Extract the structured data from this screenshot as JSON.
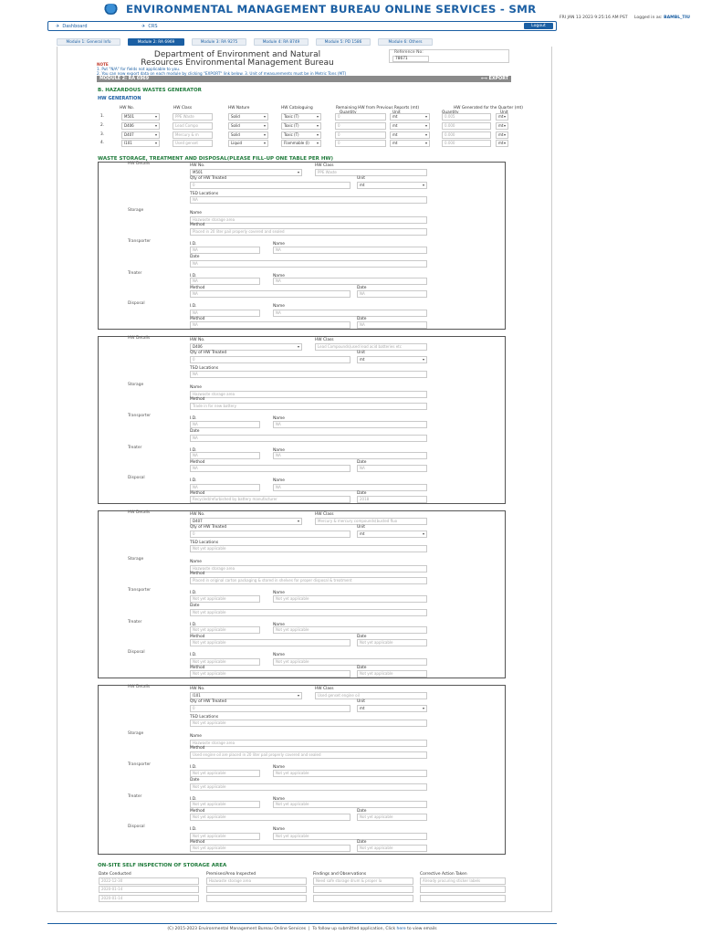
{
  "header": {
    "title": "ENVIRONMENTAL MANAGEMENT BUREAU ONLINE SERVICES - SMR",
    "datetime": "FRI JAN 13 2023 9:25:16 AM PST",
    "logged_in_label": "Logged in as:",
    "user": "BAMBL_TIU"
  },
  "nav": {
    "dashboard": "Dashboard",
    "crs": "CRS",
    "logout": "Logout"
  },
  "tabs": [
    {
      "label": "Module 1: General Info",
      "active": false
    },
    {
      "label": "Module 2: RA 6969",
      "active": true
    },
    {
      "label": "Module 3: RA 9275",
      "active": false
    },
    {
      "label": "Module 4: RA 8749",
      "active": false
    },
    {
      "label": "Module 5: PD 1586",
      "active": false
    },
    {
      "label": "Module 6: Others",
      "active": false
    }
  ],
  "dept": {
    "line1": "Department of Environment and Natural",
    "line2": "Resources Environmental Management Bureau"
  },
  "reference": {
    "label": "Reference No:",
    "value": "78671"
  },
  "note": {
    "label": "NOTE",
    "line1": "1. Put \"N/A\" for fields not applicable to you.",
    "line2": "2. You can now export data on each module by clicking \"EXPORT\" link below.  3. Unit of measurements must be in Metric Tons (MT)"
  },
  "module_bar": {
    "label": "MODULE 2: RA 6969",
    "export": "EXPORT"
  },
  "section_b": "B. HAZARDOUS WASTES GENERATOR",
  "hw_generation": {
    "title": "HW GENERATION",
    "headers": {
      "no": "HW No.",
      "class": "HW Class",
      "nature": "HW Nature",
      "cat": "HW Cataloguing",
      "remaining": "Remaining HW from Previous Reports (mt)",
      "quantity": "Quantity",
      "unit": "Unit",
      "generated": "HW Generated for the Quarter (mt)"
    },
    "rows": [
      {
        "n": "1.",
        "hw": "M501",
        "cls": "PPE Waste",
        "nature": "Solid",
        "cat": "Toxic (T)",
        "rq": "0",
        "ru": "mt",
        "gq": "0.005",
        "gu": "mt"
      },
      {
        "n": "2.",
        "hw": "D406",
        "cls": "Lead Compo",
        "nature": "Solid",
        "cat": "Toxic (T)",
        "rq": "0",
        "ru": "mt",
        "gq": "0.000",
        "gu": "mt"
      },
      {
        "n": "3.",
        "hw": "D407",
        "cls": "Mercury & m",
        "nature": "Solid",
        "cat": "Toxic (T)",
        "rq": "0",
        "ru": "mt",
        "gq": "0.000",
        "gu": "mt"
      },
      {
        "n": "4.",
        "hw": "I101",
        "cls": "Used genset",
        "nature": "Liquid",
        "cat": "Flammable (I)",
        "rq": "0",
        "ru": "mt",
        "gq": "0.000",
        "gu": "mt"
      }
    ]
  },
  "section_waste": "WASTE STORAGE, TREATMENT AND DISPOSAL(PLEASE FILL-UP ONE TABLE PER HW)",
  "labels": {
    "hw_details": "HW Details",
    "hw_no": "HW No.",
    "hw_class": "HW Class",
    "qty_treated": "Qty of HW Treated",
    "unit": "Unit",
    "tsd": "TSD Locations",
    "storage": "Storage",
    "name": "Name",
    "method": "Method",
    "transporter": "Transporter",
    "id": "I.D.",
    "date": "Date",
    "treater": "Treater",
    "disposal": "Disposal"
  },
  "tables": [
    {
      "hw": "M501",
      "cls": "PPE Waste",
      "qty": "0",
      "unit": "mt",
      "tsd": "NA",
      "st_name": "Hazwaste storage area",
      "st_method": "Placed in 20 liter pail properly covered and sealed",
      "tr_id": "NA",
      "tr_name": "NA",
      "tr_date": "NA",
      "te_id": "NA",
      "te_name": "NA",
      "te_method": "NA",
      "te_date": "NA",
      "di_id": "NA",
      "di_name": "NA",
      "di_method": "NA",
      "di_date": "NA"
    },
    {
      "hw": "D406",
      "cls": "Lead Compounds(used lead acid batteries etc",
      "qty": "0",
      "unit": "mt",
      "tsd": "NA",
      "st_name": "Hazwaste storage area",
      "st_method": "Trade in for new battery",
      "tr_id": "NA",
      "tr_name": "NA",
      "tr_date": "NA",
      "te_id": "NA",
      "te_name": "NA",
      "te_method": "NA",
      "te_date": "NA",
      "di_id": "NA",
      "di_name": "NA",
      "di_method": "Recycled/refurbished by battery manufacturer",
      "di_date": "2018"
    },
    {
      "hw": "D407",
      "cls": "Mercury & mercury compounds(busted fluo",
      "qty": "0",
      "unit": "mt",
      "tsd": "Not yet applicable",
      "st_name": "Hazwaste storage area",
      "st_method": "Placed in original carton packaging & stored in shelves for proper disposal & treatment",
      "tr_id": "Not yet applicable",
      "tr_name": "Not yet applicable",
      "tr_date": "Not yet applicable",
      "te_id": "Not yet applicable",
      "te_name": "Not yet applicable",
      "te_method": "Not yet applicable",
      "te_date": "Not yet applicable",
      "di_id": "Not yet applicable",
      "di_name": "Not yet applicable",
      "di_method": "Not yet applicable",
      "di_date": "Not yet applicable"
    },
    {
      "hw": "I101",
      "cls": "Used genset engine oil",
      "qty": "0",
      "unit": "mt",
      "tsd": "Not yet applicable",
      "st_name": "Hazwaste storage area",
      "st_method": "Used engine oil are placed in 20 liter pail properly covered and sealed",
      "tr_id": "Not yet applicable",
      "tr_name": "Not yet applicable",
      "tr_date": "Not yet applicable",
      "te_id": "Not yet applicable",
      "te_name": "Not yet applicable",
      "te_method": "Not yet applicable",
      "te_date": "Not yet applicable",
      "di_id": "Not yet applicable",
      "di_name": "Not yet applicable",
      "di_method": "Not yet applicable",
      "di_date": "Not yet applicable"
    }
  ],
  "inspection": {
    "title": "ON-SITE SELF INSPECTION OF STORAGE AREA",
    "headers": {
      "date": "Date Conducted",
      "premises": "Premises/Area Inspected",
      "findings": "Findings and Observations",
      "action": "Corrective Action Taken"
    },
    "rows": [
      {
        "date": "2022-12-30",
        "premises": "Hazwaste storage area",
        "findings": "Need safe storage drum & proper la",
        "action": "Already procuring sticker labels"
      },
      {
        "date": "2020-01-14",
        "premises": "",
        "findings": "",
        "action": ""
      },
      {
        "date": "2020-01-14",
        "premises": "",
        "findings": "",
        "action": ""
      }
    ]
  },
  "footer": {
    "copyright": "(C) 2015-2023 Environmental Management Bureau Online Services",
    "follow": "To follow up submitted application, Click",
    "here": "here",
    "email": "to view emails"
  }
}
